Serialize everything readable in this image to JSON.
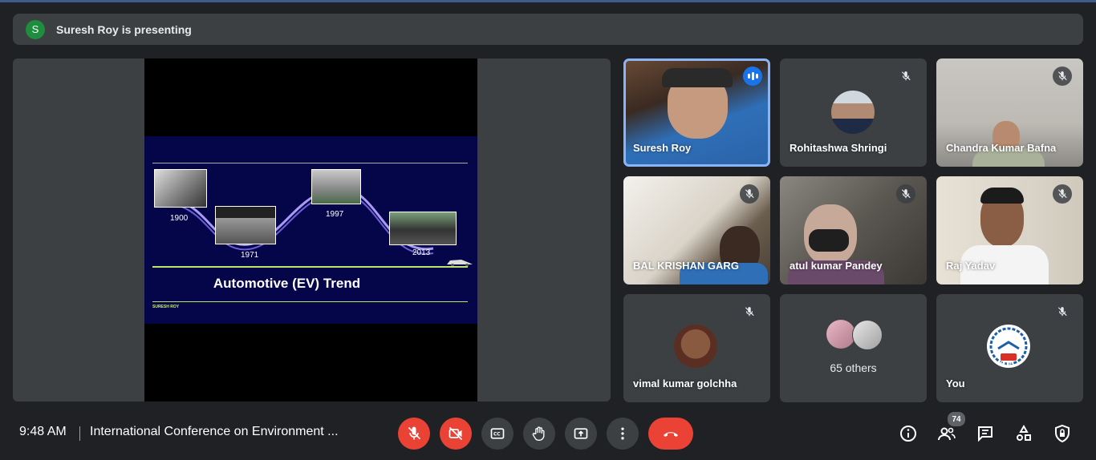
{
  "banner": {
    "avatar_letter": "S",
    "text": "Suresh Roy is presenting"
  },
  "slide": {
    "title": "Automotive (EV) Trend",
    "author": "SURESH ROY",
    "years": [
      "1900",
      "1971",
      "1997",
      "2013"
    ]
  },
  "participants": [
    {
      "name": "Suresh Roy",
      "speaking": true
    },
    {
      "name": "Rohitashwa Shringi",
      "muted": true
    },
    {
      "name": "Chandra Kumar Bafna",
      "muted": true
    },
    {
      "name": "BAL KRISHAN GARG",
      "muted": true
    },
    {
      "name": "atul kumar Pandey",
      "muted": true
    },
    {
      "name": "Raj Yadav",
      "muted": true
    },
    {
      "name": "vimal kumar golchha",
      "muted": true
    },
    {
      "name": "65 others"
    },
    {
      "name": "You",
      "muted": true,
      "logo_text": "KITE"
    }
  ],
  "bottom": {
    "time": "9:48 AM",
    "meeting_title": "International Conference on Environment ...",
    "participant_count": "74"
  },
  "colors": {
    "accent": "#8ab4f8",
    "danger": "#ea4335",
    "speaking": "#1a73e8"
  }
}
